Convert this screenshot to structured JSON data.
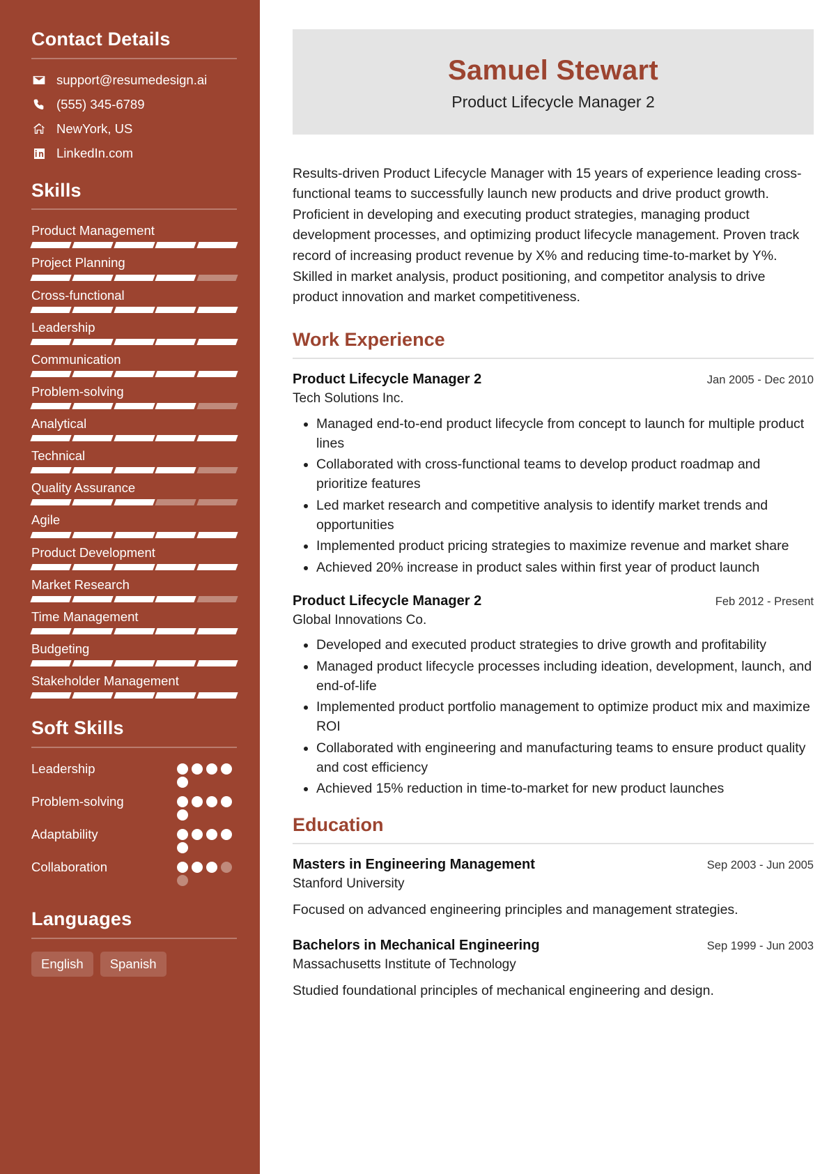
{
  "theme": {
    "accent": "#9C4430",
    "sidebar_bg": "#9C4430",
    "header_bg": "#E4E4E4",
    "muted_bar": "#C08A7B",
    "text": "#1f1f1f"
  },
  "sidebar": {
    "contact": {
      "title": "Contact Details",
      "items": [
        {
          "icon": "envelope-icon",
          "label": "support@resumedesign.ai"
        },
        {
          "icon": "phone-icon",
          "label": "(555) 345-6789"
        },
        {
          "icon": "home-icon",
          "label": "NewYork, US"
        },
        {
          "icon": "linkedin-icon",
          "label": "LinkedIn.com"
        }
      ]
    },
    "skills": {
      "title": "Skills",
      "segments_total": 5,
      "items": [
        {
          "name": "Product Management",
          "filled": 5
        },
        {
          "name": "Project Planning",
          "filled": 4
        },
        {
          "name": "Cross-functional",
          "filled": 5
        },
        {
          "name": "Leadership",
          "filled": 5
        },
        {
          "name": "Communication",
          "filled": 5
        },
        {
          "name": "Problem-solving",
          "filled": 4
        },
        {
          "name": "Analytical",
          "filled": 5
        },
        {
          "name": "Technical",
          "filled": 4
        },
        {
          "name": "Quality Assurance",
          "filled": 3
        },
        {
          "name": "Agile",
          "filled": 5
        },
        {
          "name": "Product Development",
          "filled": 5
        },
        {
          "name": "Market Research",
          "filled": 4
        },
        {
          "name": "Time Management",
          "filled": 5
        },
        {
          "name": "Budgeting",
          "filled": 5
        },
        {
          "name": "Stakeholder Management",
          "filled": 5
        }
      ]
    },
    "soft_skills": {
      "title": "Soft Skills",
      "dots_total": 5,
      "items": [
        {
          "name": "Leadership",
          "filled": 5
        },
        {
          "name": "Problem-solving",
          "filled": 5
        },
        {
          "name": "Adaptability",
          "filled": 5
        },
        {
          "name": "Collaboration",
          "filled": 3
        }
      ]
    },
    "languages": {
      "title": "Languages",
      "items": [
        "English",
        "Spanish"
      ]
    }
  },
  "main": {
    "name": "Samuel Stewart",
    "job_title": "Product Lifecycle Manager 2",
    "summary": "Results-driven Product Lifecycle Manager with 15 years of experience leading cross-functional teams to successfully launch new products and drive product growth. Proficient in developing and executing product strategies, managing product development processes, and optimizing product lifecycle management. Proven track record of increasing product revenue by X% and reducing time-to-market by Y%. Skilled in market analysis, product positioning, and competitor analysis to drive product innovation and market competitiveness.",
    "work": {
      "title": "Work Experience",
      "entries": [
        {
          "role": "Product Lifecycle Manager 2",
          "date": "Jan 2005 - Dec 2010",
          "org": "Tech Solutions Inc.",
          "bullets": [
            "Managed end-to-end product lifecycle from concept to launch for multiple product lines",
            "Collaborated with cross-functional teams to develop product roadmap and prioritize features",
            "Led market research and competitive analysis to identify market trends and opportunities",
            "Implemented product pricing strategies to maximize revenue and market share",
            "Achieved 20% increase in product sales within first year of product launch"
          ]
        },
        {
          "role": "Product Lifecycle Manager 2",
          "date": "Feb 2012 - Present",
          "org": "Global Innovations Co.",
          "bullets": [
            "Developed and executed product strategies to drive growth and profitability",
            "Managed product lifecycle processes including ideation, development, launch, and end-of-life",
            "Implemented product portfolio management to optimize product mix and maximize ROI",
            "Collaborated with engineering and manufacturing teams to ensure product quality and cost efficiency",
            "Achieved 15% reduction in time-to-market for new product launches"
          ]
        }
      ]
    },
    "education": {
      "title": "Education",
      "entries": [
        {
          "degree": "Masters in Engineering Management",
          "date": "Sep 2003 - Jun 2005",
          "school": "Stanford University",
          "description": "Focused on advanced engineering principles and management strategies."
        },
        {
          "degree": "Bachelors in Mechanical Engineering",
          "date": "Sep 1999 - Jun 2003",
          "school": "Massachusetts Institute of Technology",
          "description": "Studied foundational principles of mechanical engineering and design."
        }
      ]
    }
  }
}
